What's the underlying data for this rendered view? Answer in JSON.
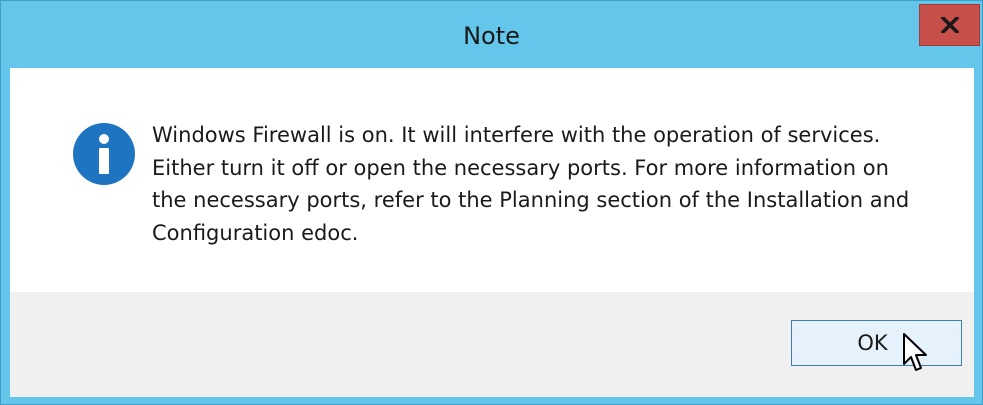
{
  "dialog": {
    "title": "Note",
    "message": "Windows Firewall is on. It will interfere with the operation of services.\nEither turn it off or open the necessary ports. For more information on\nthe necessary ports, refer to the Planning section of the Installation and\nConfiguration edoc.",
    "icon": "info-icon",
    "ok_label": "OK",
    "close_icon": "close-icon"
  },
  "colors": {
    "titlebar": "#63c6ea",
    "close_button": "#c7504b",
    "info_icon": "#1e74c0",
    "ok_button_bg": "#e5f1fb",
    "ok_button_border": "#3c7fb1",
    "footer_bg": "#f0f0f0"
  }
}
